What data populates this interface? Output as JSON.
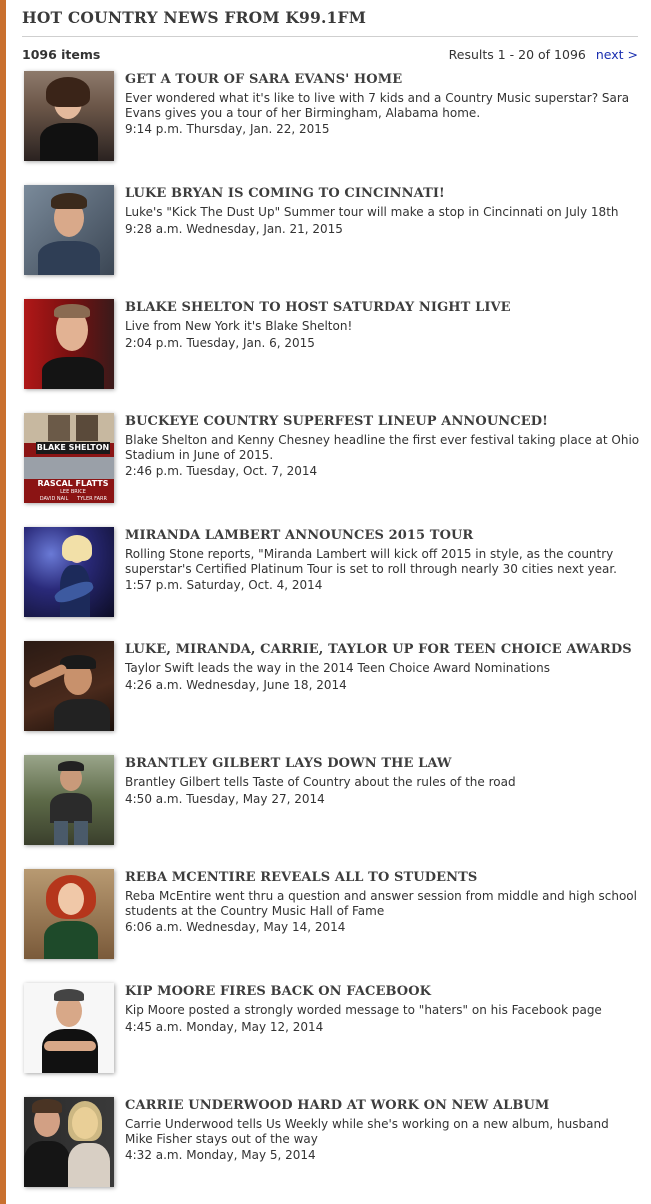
{
  "section": {
    "title": "HOT COUNTRY NEWS FROM K99.1FM"
  },
  "meta": {
    "count": "1096 items",
    "results": "Results 1 - 20 of 1096",
    "next": "next >"
  },
  "colors": {
    "accent_border": "#c9702f",
    "link": "#1a2fb0"
  },
  "items": [
    {
      "title": "GET A TOUR OF SARA EVANS' HOME",
      "summary": "Ever wondered what it's like to live with 7 kids and a Country Music superstar? Sara Evans gives you a tour of her Birmingham, Alabama home.",
      "date": "9:14 p.m. Thursday, Jan. 22, 2015"
    },
    {
      "title": "LUKE BRYAN IS COMING TO CINCINNATI!",
      "summary": "Luke's \"Kick The Dust Up\" Summer tour will make a stop in Cincinnati on July 18th",
      "date": "9:28 a.m. Wednesday, Jan. 21, 2015"
    },
    {
      "title": "BLAKE SHELTON TO HOST SATURDAY NIGHT LIVE",
      "summary": "Live from New York it's Blake Shelton!",
      "date": "2:04 p.m. Tuesday, Jan. 6, 2015"
    },
    {
      "title": "BUCKEYE COUNTRY SUPERFEST LINEUP ANNOUNCED!",
      "summary": "Blake Shelton and Kenny Chesney headline the first ever festival taking place at Ohio Stadium in June of 2015.",
      "date": "2:46 p.m. Tuesday, Oct. 7, 2014",
      "thumb_text": [
        "BLAKE SHELTON",
        "RASCAL FLATTS",
        "LEE BRICE",
        "DAVID NAIL",
        "TYLER FARR"
      ]
    },
    {
      "title": "MIRANDA LAMBERT ANNOUNCES 2015 TOUR",
      "summary": "Rolling Stone reports, \"Miranda Lambert will kick off 2015 in style, as the country superstar's Certified Platinum Tour is set to roll through nearly 30 cities next year.",
      "date": "1:57 p.m. Saturday, Oct. 4, 2014"
    },
    {
      "title": "LUKE, MIRANDA, CARRIE, TAYLOR UP FOR TEEN CHOICE AWARDS",
      "summary": "Taylor Swift leads the way in the 2014 Teen Choice Award Nominations",
      "date": "4:26 a.m. Wednesday, June 18, 2014"
    },
    {
      "title": "BRANTLEY GILBERT LAYS DOWN THE LAW",
      "summary": "Brantley Gilbert tells Taste of Country about the rules of the road",
      "date": "4:50 a.m. Tuesday, May 27, 2014"
    },
    {
      "title": "REBA MCENTIRE REVEALS ALL TO STUDENTS",
      "summary": "Reba McEntire went thru a question and answer session from middle and high school students at the Country Music Hall of Fame",
      "date": "6:06 a.m. Wednesday, May 14, 2014"
    },
    {
      "title": "KIP MOORE FIRES BACK ON FACEBOOK",
      "summary": "Kip Moore posted a strongly worded message to \"haters\" on his Facebook page",
      "date": "4:45 a.m. Monday, May 12, 2014"
    },
    {
      "title": "CARRIE UNDERWOOD HARD AT WORK ON NEW ALBUM",
      "summary": "Carrie Underwood tells Us Weekly while she's working on a new album, husband Mike Fisher stays out of the way",
      "date": "4:32 a.m. Monday, May 5, 2014"
    }
  ]
}
